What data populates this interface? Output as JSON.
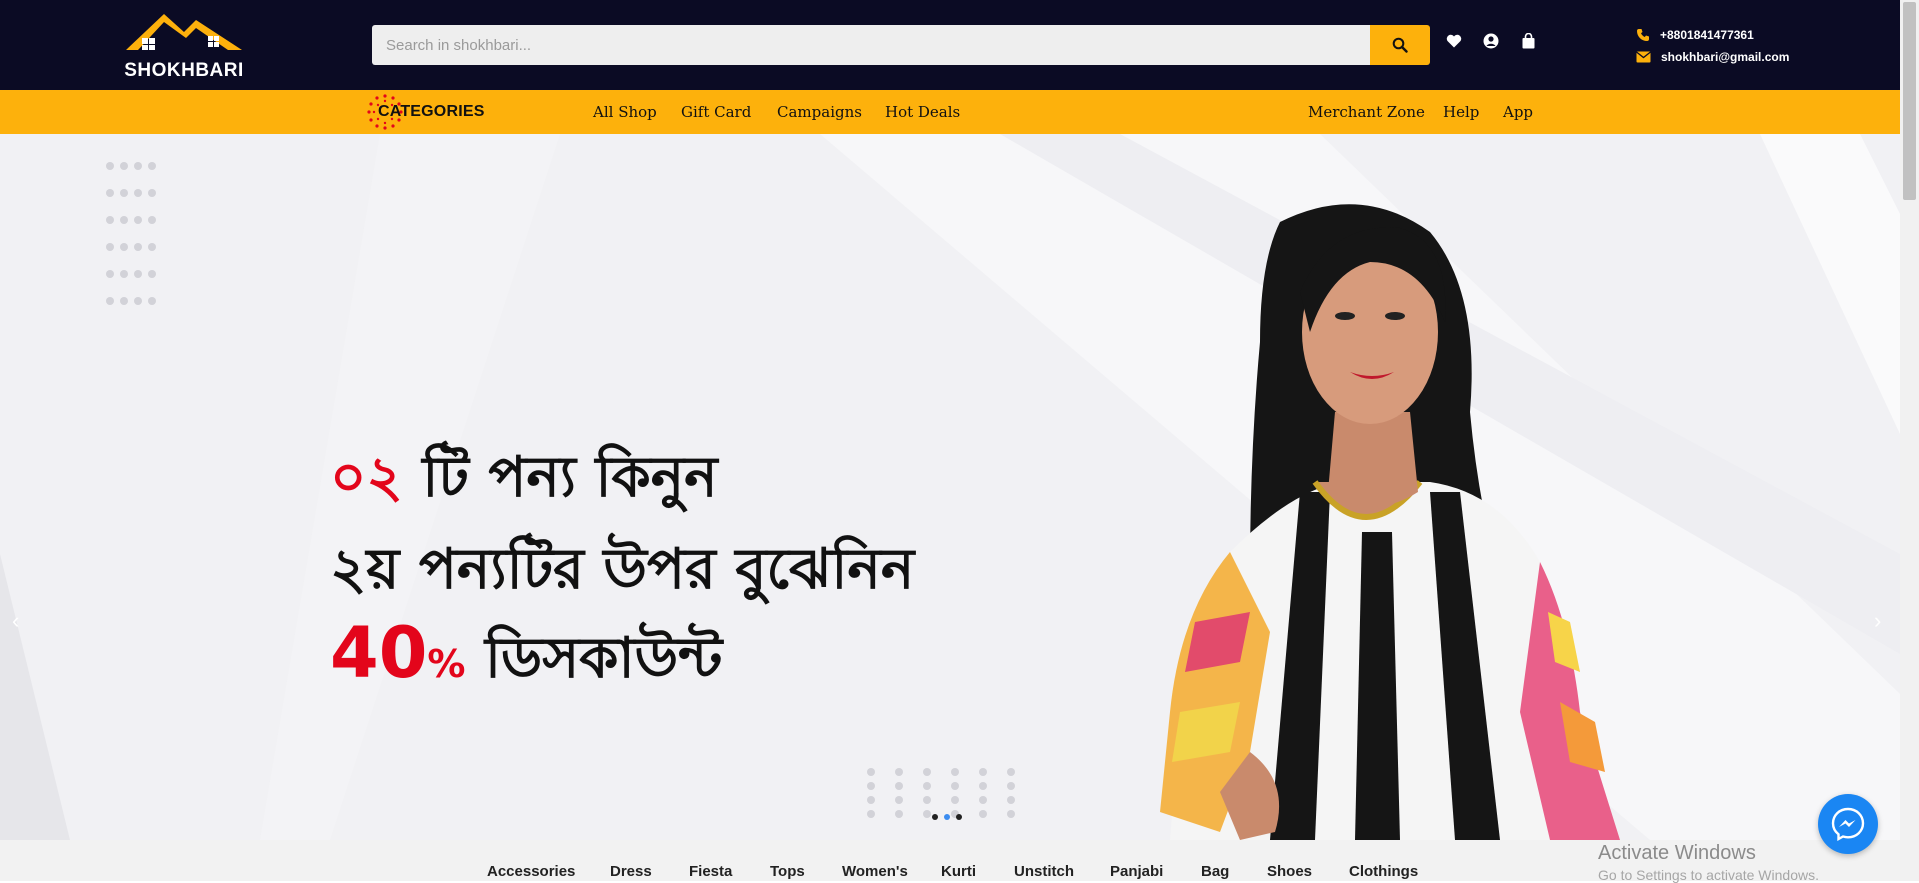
{
  "header": {
    "logo_text": "SHOKHBARI",
    "search_placeholder": "Search in shokhbari...",
    "phone": "+8801841477361",
    "email": "shokhbari@gmail.com",
    "icons": [
      "heart-icon",
      "user-icon",
      "bag-icon"
    ],
    "accent": "#fdb10c",
    "bg": "#0b0b24"
  },
  "nav": {
    "categories_label": "CATEGORIES",
    "links": [
      "All Shop",
      "Gift Card",
      "Campaigns",
      "Hot Deals"
    ],
    "right_links": [
      "Merchant Zone",
      "Help",
      "App"
    ]
  },
  "hero": {
    "line1_red": "০২",
    "line1": "টি পন্য কিনুন",
    "line2": "২য় পন্যটির উপর বুঝেনিন",
    "line3_red": "40",
    "line3_pct": "%",
    "line3": "ডিসকাউন্ট",
    "slides": 3,
    "active_slide": 2
  },
  "category_strip": {
    "items": [
      "Accessories",
      "Dress",
      "Fiesta",
      "Tops",
      "Women's",
      "Kurti",
      "Unstitch",
      "Panjabi",
      "Bag",
      "Shoes",
      "Clothings"
    ]
  },
  "system": {
    "watermark_title": "Activate Windows",
    "watermark_sub": "Go to Settings to activate Windows."
  }
}
